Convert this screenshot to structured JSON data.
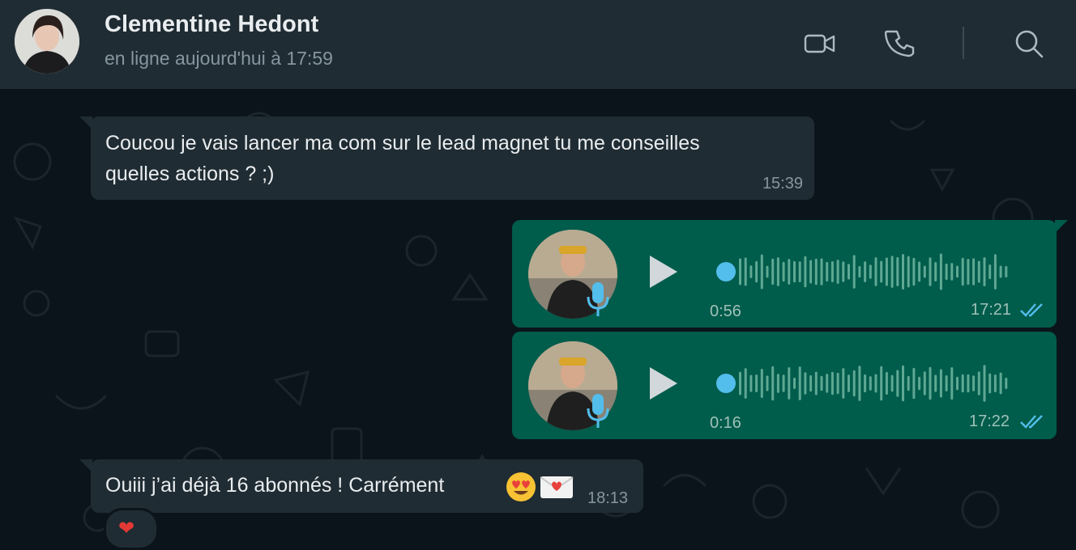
{
  "header": {
    "contact_name": "Clementine Hedont",
    "status": "en ligne aujourd'hui à 17:59",
    "icons": [
      "video-call-icon",
      "voice-call-icon",
      "search-icon"
    ]
  },
  "messages": [
    {
      "direction": "incoming",
      "type": "text",
      "lines": [
        "Coucou je vais lancer ma com sur le lead magnet tu me conseilles",
        "quelles actions ? ;)"
      ],
      "time": "15:39"
    },
    {
      "direction": "outgoing",
      "type": "voice",
      "duration": "0:56",
      "time": "17:21",
      "read": true,
      "progress": 0
    },
    {
      "direction": "outgoing",
      "type": "voice",
      "duration": "0:16",
      "time": "17:22",
      "read": true,
      "progress": 0
    },
    {
      "direction": "incoming",
      "type": "text",
      "text": "Ouiii j’ai déjà 16 abonnés ! Carrément",
      "emojis": [
        "smiling-face-with-heart-eyes",
        "love-letter"
      ],
      "time": "18:13",
      "reaction": "❤"
    }
  ],
  "colors": {
    "header_bg": "#202c33",
    "chat_bg": "#0b141a",
    "incoming_bubble": "#202c33",
    "outgoing_bubble": "#005c4b",
    "read_ticks": "#53bdeb",
    "waveform_played_dot": "#53bdeb"
  }
}
